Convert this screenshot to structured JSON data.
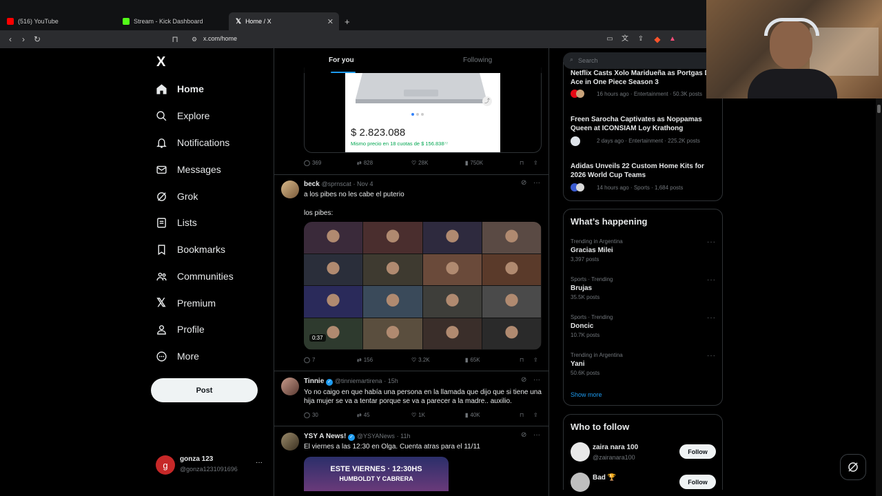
{
  "browser": {
    "tabs": [
      {
        "title": "(516) YouTube",
        "color": "#ff0000"
      },
      {
        "title": "Stream - Kick Dashboard",
        "color": "#53fc18"
      },
      {
        "title": "Home / X",
        "color": "#ffffff"
      }
    ],
    "new_tab": "+",
    "url": "x.com/home"
  },
  "nav": {
    "logo": "X",
    "items": [
      {
        "label": "Home",
        "icon": "home-icon"
      },
      {
        "label": "Explore",
        "icon": "search-icon"
      },
      {
        "label": "Notifications",
        "icon": "bell-icon"
      },
      {
        "label": "Messages",
        "icon": "envelope-icon"
      },
      {
        "label": "Grok",
        "icon": "grok-icon"
      },
      {
        "label": "Lists",
        "icon": "list-icon"
      },
      {
        "label": "Bookmarks",
        "icon": "bookmark-icon"
      },
      {
        "label": "Communities",
        "icon": "people-icon"
      },
      {
        "label": "Premium",
        "icon": "x-icon"
      },
      {
        "label": "Profile",
        "icon": "person-icon"
      },
      {
        "label": "More",
        "icon": "more-circle-icon"
      }
    ],
    "post_button": "Post",
    "account": {
      "name": "gonza 123",
      "handle": "@gonza1231091696",
      "initial": "g",
      "more": "···"
    }
  },
  "feed": {
    "tabs": [
      "For you",
      "Following"
    ],
    "product_card": {
      "price": "$ 2.823.088",
      "installments": "Mismo precio en 18 cuotas de $ 156.838⁷⁷"
    },
    "posts": [
      {
        "replies": "369",
        "reposts": "828",
        "likes": "28K",
        "views": "750K"
      },
      {
        "name": "beck",
        "handle": "@sprnscat",
        "time": "· Nov 4",
        "text1": "a los pibes no les cabe el puterio",
        "text2": "los pibes:",
        "video_time": "0:37",
        "replies": "7",
        "reposts": "156",
        "likes": "3.2K",
        "views": "65K"
      },
      {
        "name": "Tinnie",
        "handle": "@tinniemartirena",
        "time": "· 15h",
        "text1": "Yo no caigo en que había una persona en la llamada que dijo que si tiene una",
        "text2": "hija mujer se va a tentar porque se va a parecer a la madre.. auxilio.",
        "replies": "30",
        "reposts": "45",
        "likes": "1K",
        "views": "40K"
      },
      {
        "name": "YSY A News!",
        "handle": "@YSYANews",
        "time": "· 11h",
        "text1": "El viernes a las 12:30 en Olga. Cuenta atras para el 11/11",
        "banner1": "ESTE VIERNES · 12:30HS",
        "banner2": "HUMBOLDT Y CABRERA"
      }
    ]
  },
  "sidebar": {
    "search_placeholder": "Search",
    "news": [
      {
        "title1": "Netflix Casts Xolo Maridueña as Portgas D.",
        "title2": "Ace in One Piece Season 3",
        "meta": "16 hours ago · Entertainment · 50.3K posts"
      },
      {
        "title1": "Freen Sarocha Captivates as Noppamas",
        "title2": "Queen at ICONSIAM Loy Krathong",
        "meta": "2 days ago · Entertainment · 225.2K posts"
      },
      {
        "title1": "Adidas Unveils 22 Custom Home Kits for",
        "title2": "2026 World Cup Teams",
        "meta": "14 hours ago · Sports · 1,684 posts"
      }
    ],
    "whats_happening": {
      "title": "What’s happening",
      "trends": [
        {
          "context": "Trending in Argentina",
          "name": "Gracias Milei",
          "posts": "3,397 posts"
        },
        {
          "context": "Sports · Trending",
          "name": "Brujas",
          "posts": "35.5K posts"
        },
        {
          "context": "Sports · Trending",
          "name": "Doncic",
          "posts": "10.7K posts"
        },
        {
          "context": "Trending in Argentina",
          "name": "Yani",
          "posts": "50.6K posts"
        }
      ],
      "show_more": "Show more"
    },
    "who_to_follow": {
      "title": "Who to follow",
      "users": [
        {
          "name": "zaira nara 100",
          "handle": "@zairanara100",
          "button": "Follow"
        },
        {
          "name": "Bad 🏆",
          "handle": "",
          "button": "Follow"
        }
      ]
    }
  },
  "colors": {
    "accent": "#1d9bf0",
    "green": "#00ba7c",
    "bg": "#000000",
    "border": "#2f3336"
  }
}
